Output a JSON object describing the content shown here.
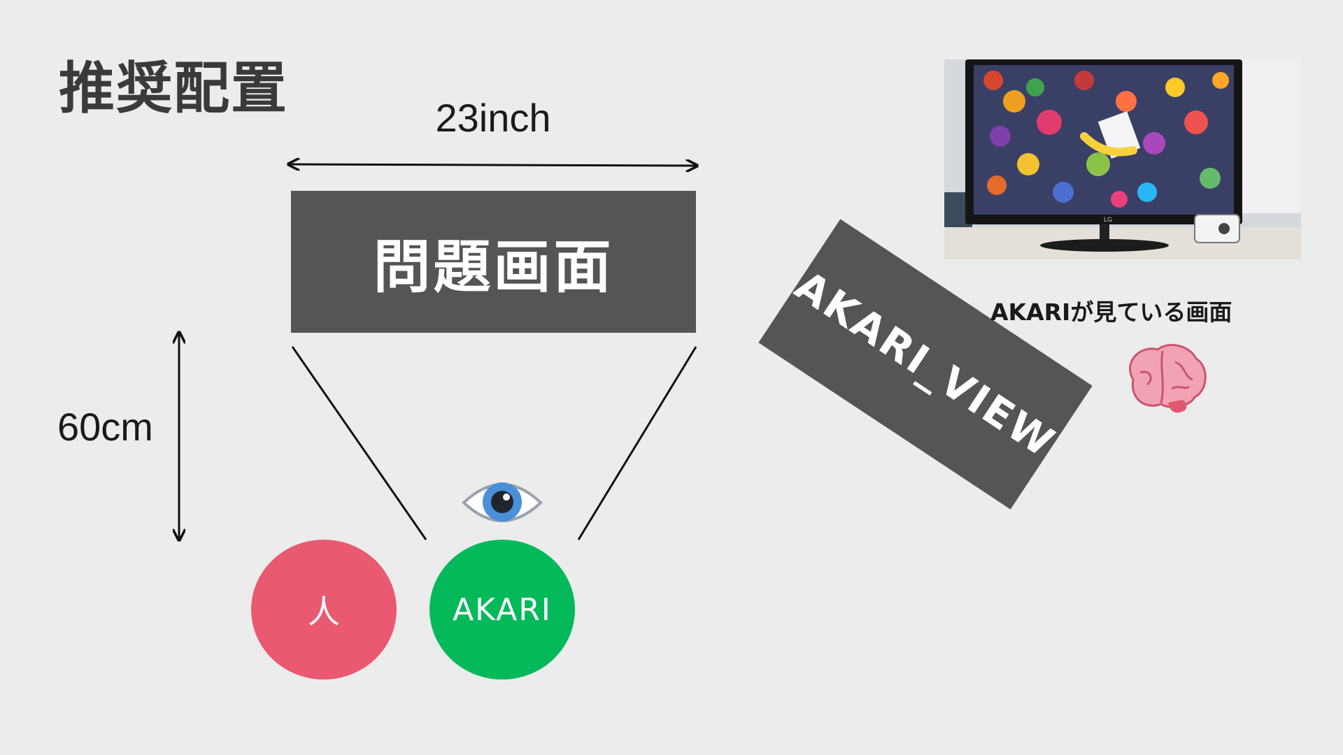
{
  "title": "推奨配置",
  "dimensions": {
    "width_label": "23inch",
    "distance_label": "60cm"
  },
  "problem_screen": {
    "label": "問題画面"
  },
  "akari_view": {
    "label": "AKARI_VIEW"
  },
  "participants": {
    "person_label": "人",
    "akari_label": "AKARI"
  },
  "photo": {
    "caption": "AKARIが見ている画面",
    "monitor_brand": "LG"
  },
  "icons": {
    "eye": "eye-icon",
    "brain": "brain-icon"
  },
  "colors": {
    "background": "#ececec",
    "screen_box": "#555555",
    "person": "#e95a70",
    "akari": "#04b95a"
  }
}
